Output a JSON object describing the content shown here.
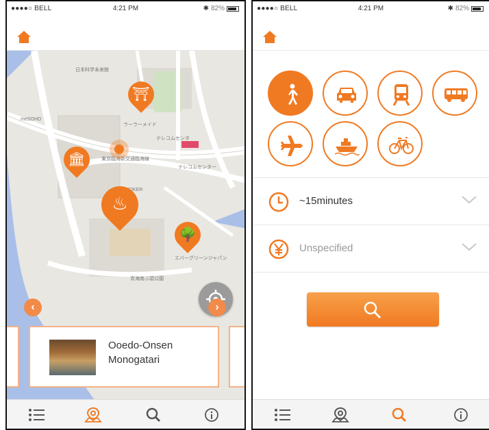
{
  "status": {
    "carrier": "●●●●○ BELL",
    "time": "4:21 PM",
    "battery": "82%"
  },
  "colors": {
    "accent": "#f07a22",
    "map_bg": "#e8e6df",
    "water": "#a9bfe8"
  },
  "map_screen": {
    "header_icon": "home-icon",
    "pins": [
      "museum-pin",
      "temple-pin",
      "onsen-pin",
      "park-pin"
    ],
    "card": {
      "title_line1": "Ooedo-Onsen",
      "title_line2": "Monogatari"
    },
    "prev_label": "‹",
    "next_label": "›",
    "tabs": [
      "list-icon",
      "map-pin-icon",
      "search-icon",
      "info-icon"
    ],
    "active_tab": "map-pin-icon"
  },
  "search_screen": {
    "header_icon": "home-icon",
    "modes": [
      "walk",
      "car",
      "train",
      "bus",
      "plane",
      "ship",
      "bicycle"
    ],
    "active_mode": "walk",
    "time_filter": {
      "label": "~15minutes"
    },
    "price_filter": {
      "label": "Unspecified"
    },
    "tabs": [
      "list-icon",
      "map-pin-icon",
      "search-icon",
      "info-icon"
    ],
    "active_tab": "search-icon"
  }
}
